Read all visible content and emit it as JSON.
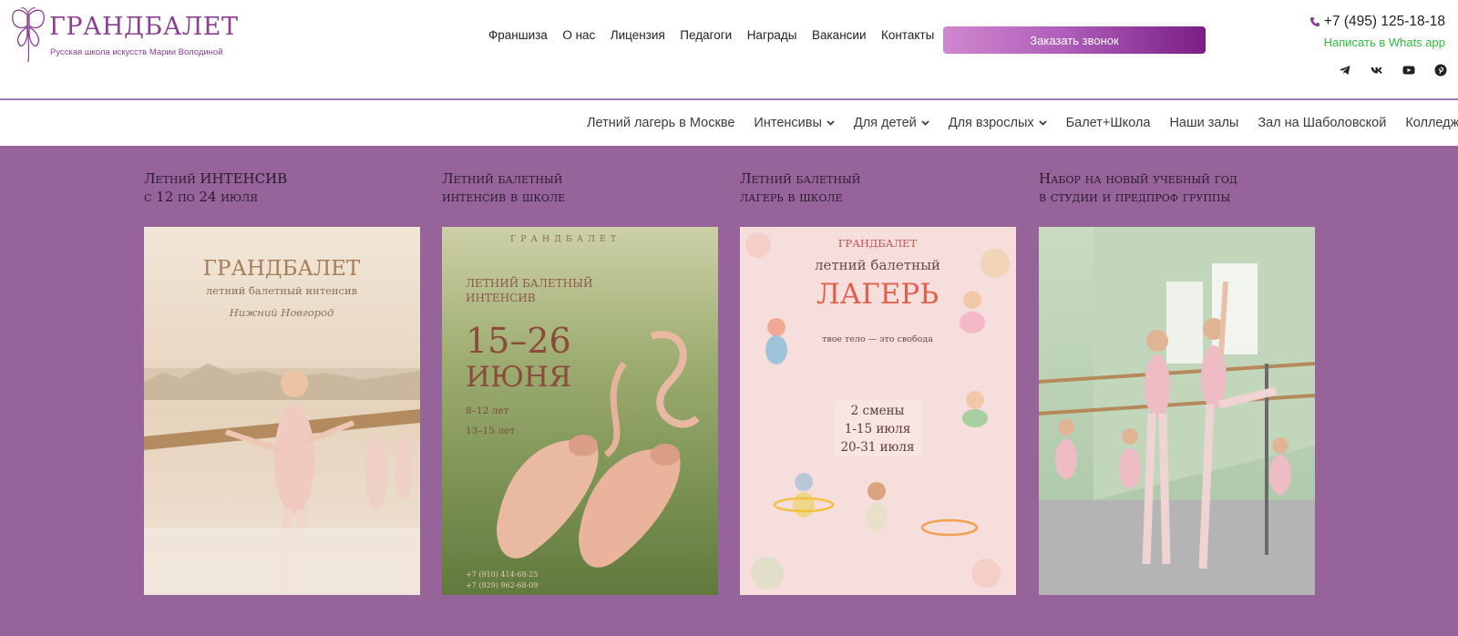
{
  "logo": {
    "title": "ГРАНДБАЛЕТ",
    "subtitle": "Русская школа искусств Марии Володиной"
  },
  "topnav": {
    "items": [
      "Франшиза",
      "О нас",
      "Лицензия",
      "Педагоги",
      "Награды",
      "Вакансии",
      "Контакты"
    ]
  },
  "cta": {
    "label": "Заказать звонок"
  },
  "contacts": {
    "phone": "+7 (495) 125-18-18",
    "whatsapp": "Написать в Whats app",
    "socials": [
      "telegram-icon",
      "vk-icon",
      "youtube-icon",
      "pinterest-icon"
    ]
  },
  "subnav": {
    "items": [
      {
        "label": "Летний лагерь в Москве",
        "dropdown": false
      },
      {
        "label": "Интенсивы",
        "dropdown": true
      },
      {
        "label": "Для детей",
        "dropdown": true
      },
      {
        "label": "Для взрослых",
        "dropdown": true
      },
      {
        "label": "Балет+Школа",
        "dropdown": false
      },
      {
        "label": "Наши залы",
        "dropdown": false
      },
      {
        "label": "Зал на Шаболовской",
        "dropdown": false
      },
      {
        "label": "Колледж",
        "dropdown": false
      }
    ]
  },
  "cards": [
    {
      "title_line1": "Летний ИНТЕНСИВ",
      "title_line2": "с 12 по 24 июля",
      "poster": {
        "brand": "ГРАНДБАЛЕТ",
        "line1": "летний балетный интенсив",
        "line2": "Нижний Новгород"
      }
    },
    {
      "title_line1": "Летний балетный",
      "title_line2": "интенсив в школе",
      "poster": {
        "brand": "ГРАНДБАЛЕТ",
        "line1": "ЛЕТНИЙ БАЛЕТНЫЙ",
        "line2": "ИНТЕНСИВ",
        "dates": "15–26",
        "month": "ИЮНЯ",
        "age1": "8–12 лет",
        "age2": "13–15 лет",
        "phone1": "+7 (910) 414-68-25",
        "phone2": "+7 (929) 962-68-09"
      }
    },
    {
      "title_line1": "Летний балетный",
      "title_line2": "лагерь в школе",
      "poster": {
        "brand": "ГРАНДБАЛЕТ",
        "line1": "летний балетный",
        "big": "ЛАГЕРЬ",
        "tagline": "твое тело — это свобода",
        "shifts": "2 смены",
        "shift1": "1-15 июля",
        "shift2": "20-31 июля"
      }
    },
    {
      "title_line1": "Набор на новый учебный год",
      "title_line2": "в студии и предпроф группы",
      "poster": {}
    }
  ],
  "colors": {
    "brand_purple": "#8a3f92",
    "main_bg": "#96649a",
    "whatsapp_green": "#2fbd3c"
  }
}
